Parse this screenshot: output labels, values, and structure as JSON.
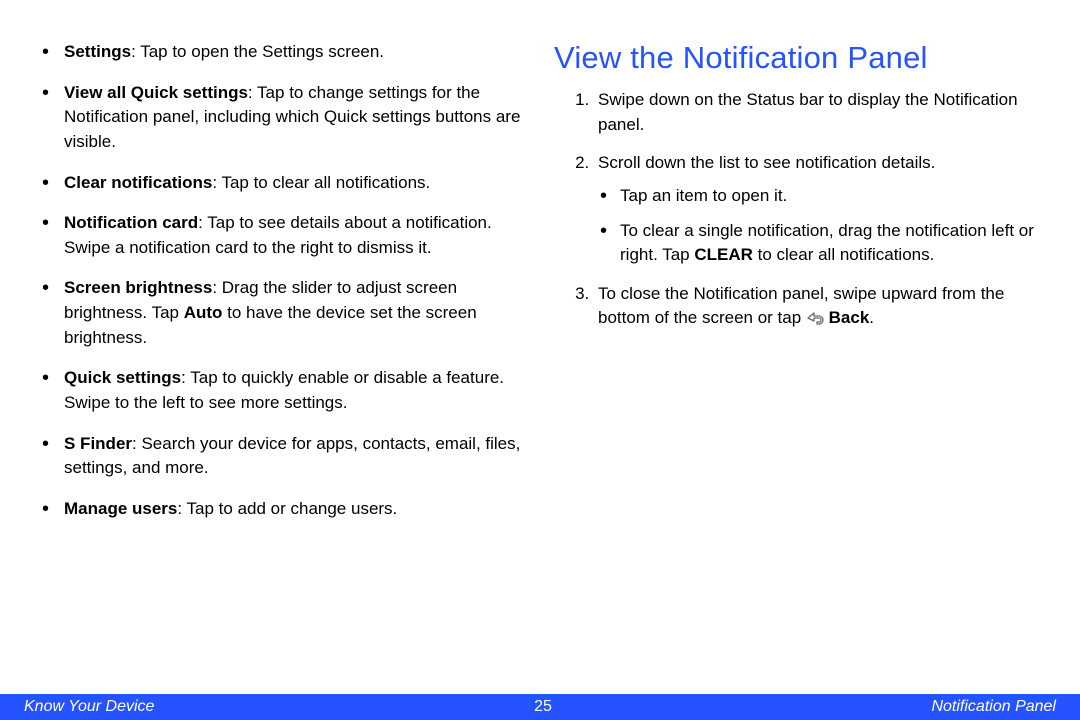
{
  "left": {
    "items": [
      {
        "bold": "Settings",
        "rest": ": Tap to open the Settings screen."
      },
      {
        "bold": "View all Quick settings",
        "rest": ": Tap to change settings for the Notification panel, including which Quick settings buttons are visible."
      },
      {
        "bold": "Clear notifications",
        "rest": ": Tap to clear all notifications."
      },
      {
        "bold": "Notification card",
        "rest": ": Tap to see details about a notification. Swipe a notification card to the right to dismiss it."
      },
      {
        "bold": "Screen brightness",
        "rest_a": ": Drag the slider to adjust screen brightness. Tap ",
        "bold_b": "Auto",
        "rest_b": " to have the device set the screen brightness."
      },
      {
        "bold": "Quick settings",
        "rest": ": Tap to quickly enable or disable a feature. Swipe to the left to see more settings."
      },
      {
        "bold": "S Finder",
        "rest": ": Search your device for apps, contacts, email, files, settings, and more."
      },
      {
        "bold": "Manage users",
        "rest": ": Tap to add or change users."
      }
    ]
  },
  "right": {
    "heading": "View the Notification Panel",
    "step1": "Swipe down on the Status bar to display the Notification panel.",
    "step2": "Scroll down the list to see notification details.",
    "sub_a": "Tap an item to open it.",
    "sub_b_a": "To clear a single notification, drag the notification left or right. Tap ",
    "sub_b_bold": "CLEAR",
    "sub_b_b": " to clear all notifications.",
    "step3_a": "To close the Notification panel, swipe upward from the bottom of the screen or tap ",
    "step3_bold": "Back",
    "step3_b": "."
  },
  "footer": {
    "left": "Know Your Device",
    "page": "25",
    "right": "Notification Panel"
  }
}
